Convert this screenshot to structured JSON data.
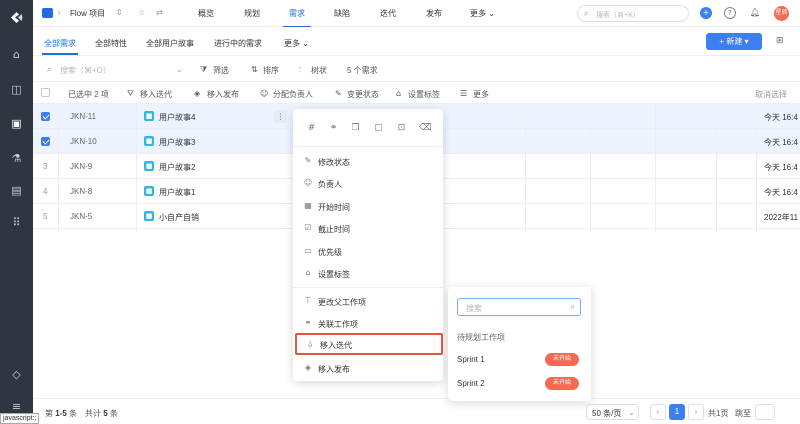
{
  "topbar": {
    "project_name": "Flow 项目",
    "nav_tabs": [
      "概览",
      "规划",
      "需求",
      "缺陷",
      "迭代",
      "发布",
      "更多"
    ],
    "active_tab": "需求",
    "search_placeholder": "搜索（⌘+K）",
    "avatar_text": "星辰"
  },
  "subtabs": {
    "items": [
      "全部需求",
      "全部特性",
      "全部用户故事",
      "进行中的需求",
      "更多"
    ],
    "active": "全部需求",
    "new_button": "新建"
  },
  "filterbar": {
    "search_placeholder": "搜索（⌘+O）",
    "filter": "筛选",
    "sort": "排序",
    "tree": "树状",
    "count": "5 个需求"
  },
  "selbar": {
    "selected_prefix": "已选中",
    "selected_count": "2",
    "selected_suffix": "项",
    "actions": [
      "移入迭代",
      "移入发布",
      "分配负责人",
      "变更状态",
      "设置标签",
      "更多"
    ],
    "cancel": "取消选择"
  },
  "rows": [
    {
      "num": "",
      "id": "JKN-11",
      "title": "用户故事4",
      "time": "今天 16:4",
      "selected": true
    },
    {
      "num": "",
      "id": "JKN-10",
      "title": "用户故事3",
      "time": "今天 16:4",
      "selected": true
    },
    {
      "num": "3",
      "id": "JKN-9",
      "title": "用户故事2",
      "time": "今天 16:4",
      "selected": false
    },
    {
      "num": "4",
      "id": "JKN-8",
      "title": "用户故事1",
      "time": "今天 16:4",
      "selected": false
    },
    {
      "num": "5",
      "id": "JKN-5",
      "title": "小自产自销",
      "time": "2022年11",
      "selected": false
    }
  ],
  "context_menu": {
    "items": [
      "修改状态",
      "负责人",
      "开始时间",
      "截止时间",
      "优先级",
      "设置标签",
      "更改父工作项",
      "关联工作项",
      "移入迭代",
      "移入发布"
    ],
    "highlighted": "移入迭代"
  },
  "submenu": {
    "search_placeholder": "搜索",
    "section_title": "待规划工作项",
    "sprints": [
      {
        "name": "Sprint 1",
        "status": "未开始"
      },
      {
        "name": "Sprint 2",
        "status": "未开始"
      }
    ]
  },
  "footer": {
    "range_prefix": "第",
    "range": "1-5",
    "range_suffix": "条",
    "total_prefix": "共计",
    "total": "5",
    "total_suffix": "条",
    "per_page": "50 条/页",
    "current_page": "1",
    "pages_text": "共1页",
    "jump_label": "跳至"
  },
  "status_tag": "javascript:;",
  "colors": {
    "accent": "#3c7ff0",
    "highlight": "#e4573d",
    "rail": "#2f3541",
    "badge": "#f26b55"
  }
}
